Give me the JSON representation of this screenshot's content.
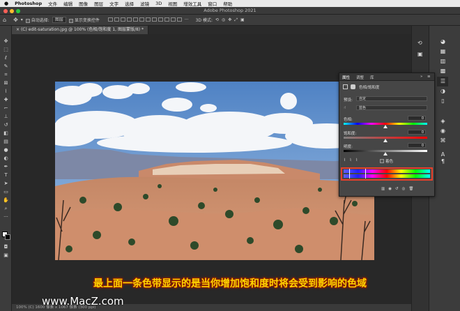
{
  "menubar": {
    "app": "Photoshop",
    "items": [
      "文件",
      "编辑",
      "图像",
      "图层",
      "文字",
      "选择",
      "滤镜",
      "3D",
      "视图",
      "增效工具",
      "窗口",
      "帮助"
    ]
  },
  "window": {
    "title": "Adobe Photoshop 2021"
  },
  "options": {
    "auto_select_label": "自动选择:",
    "auto_select_value": "图层",
    "show_transform_label": "显示变换控件",
    "mode_label": "3D 模式:"
  },
  "doc_tab": {
    "label": "(C) edit-saturation.jpg @ 100% (色相/饱和度 1, 图层蒙版/8) *"
  },
  "properties": {
    "tabs": [
      "属性",
      "调整",
      "库"
    ],
    "panel_title": "色相/饱和度",
    "preset_label": "预设:",
    "preset_value": "自定",
    "channel_value": "蓝色",
    "hue_label": "色相:",
    "hue_value": "0",
    "saturation_label": "饱和度:",
    "saturation_value": "0",
    "lightness_label": "明度:",
    "lightness_value": "0",
    "colorize_label": "着色"
  },
  "dock_labels": {
    "a_label": "A",
    "param_label": "¶"
  },
  "subtitle": "最上面一条色带显示的是当你增加饱和度时将会受到影响的色域",
  "status": {
    "text": "100%    (C) 1600 像素 x 1067 像素 (300 ppi)"
  },
  "watermark": "www.MacZ.com",
  "colors": {
    "highlight_box": "#e8402a",
    "subtitle": "#ffd400",
    "photo_sky": "#5f8fc8"
  }
}
